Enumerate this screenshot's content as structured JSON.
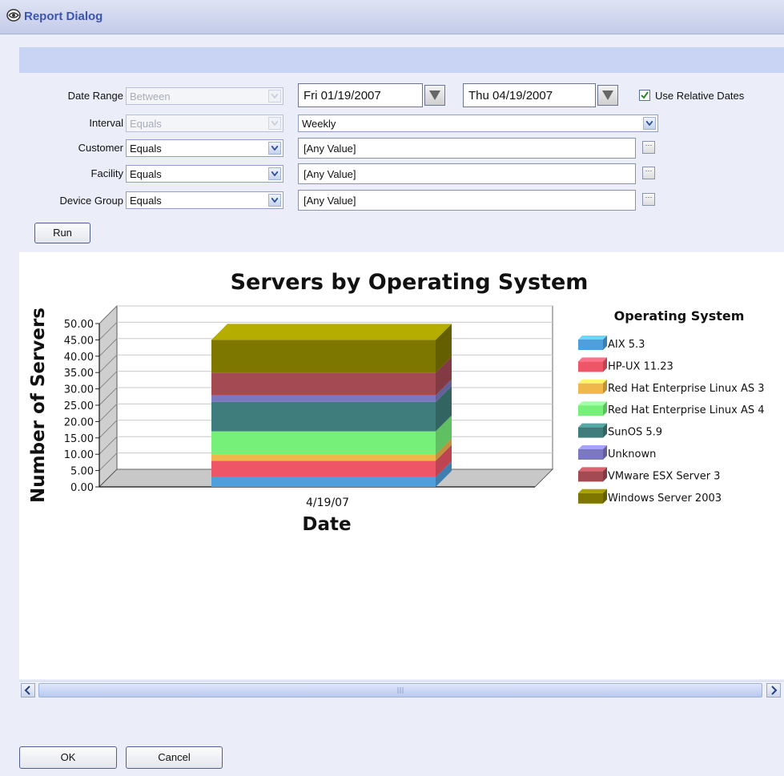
{
  "window": {
    "title": "Report Dialog"
  },
  "filters": {
    "date_range": {
      "label": "Date Range",
      "operator": "Between",
      "start": "Fri 01/19/2007",
      "end": "Thu 04/19/2007"
    },
    "use_relative": {
      "label": "Use Relative Dates",
      "checked": true
    },
    "interval": {
      "label": "Interval",
      "operator": "Equals",
      "value": "Weekly"
    },
    "customer": {
      "label": "Customer",
      "operator": "Equals",
      "value": "[Any Value]"
    },
    "facility": {
      "label": "Facility",
      "operator": "Equals",
      "value": "[Any Value]"
    },
    "device_group": {
      "label": "Device Group",
      "operator": "Equals",
      "value": "[Any Value]"
    }
  },
  "buttons": {
    "run": "Run",
    "ok": "OK",
    "cancel": "Cancel"
  },
  "icons": {
    "title": "report-app-icon",
    "dropdown": "chevron-down-icon",
    "date_picker": "triangle-down-icon",
    "ellipsis": "ellipsis-icon",
    "scroll_left": "arrow-left-icon",
    "scroll_right": "arrow-right-icon",
    "scroll_grip": "grip-icon"
  },
  "chart_data": {
    "type": "bar",
    "stacked": true,
    "style": "3d",
    "title": "Servers by Operating System",
    "xlabel": "Date",
    "ylabel": "Number of Servers",
    "categories": [
      "4/19/07"
    ],
    "ylim": [
      0,
      50
    ],
    "yticks": [
      "0.00",
      "5.00",
      "10.00",
      "15.00",
      "20.00",
      "25.00",
      "30.00",
      "35.00",
      "40.00",
      "45.00",
      "50.00"
    ],
    "legend_title": "Operating System",
    "legend_position": "right",
    "grid": true,
    "series": [
      {
        "name": "AIX 5.3",
        "values": [
          3
        ],
        "color": "#4f9fdc"
      },
      {
        "name": "HP-UX 11.23",
        "values": [
          5
        ],
        "color": "#ee5566"
      },
      {
        "name": "Red Hat Enterprise Linux AS 3",
        "values": [
          2
        ],
        "color": "#f0b74a"
      },
      {
        "name": "Red Hat Enterprise Linux AS 4",
        "values": [
          7
        ],
        "color": "#77f07a"
      },
      {
        "name": "SunOS 5.9",
        "values": [
          9
        ],
        "color": "#3e7d7b"
      },
      {
        "name": "Unknown",
        "values": [
          2
        ],
        "color": "#7c78c0"
      },
      {
        "name": "VMware ESX Server 3",
        "values": [
          7
        ],
        "color": "#a34a53"
      },
      {
        "name": "Windows Server 2003",
        "values": [
          10
        ],
        "color": "#7d7700"
      }
    ]
  }
}
